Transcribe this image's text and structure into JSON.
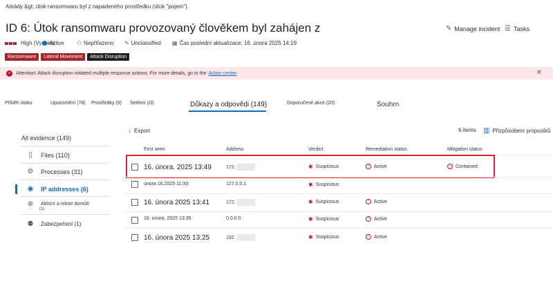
{
  "breadcrumb": "Arkády &gt; útok ransomwaru byl z napadeného prostředku (útok \"pojem\").",
  "title": "ID 6: Útok ransomwaru provozovaný člověkem byl zahájen z compu",
  "header_actions": {
    "manage": "Manage incident",
    "tasks": "Tasks"
  },
  "meta": {
    "severity": "High (Vysoká)",
    "status": "Active",
    "assigned": "Nepřiřazeno",
    "classification": "Unclassified",
    "last_update": "Čas poslední aktualizace: 16. února 2025 14:19"
  },
  "tags": [
    {
      "label": "Ransomware",
      "color": "#a4262c"
    },
    {
      "label": "Lateral Movement",
      "color": "#a4262c"
    },
    {
      "label": "Attack Disruption",
      "color": "#201f1e"
    }
  ],
  "banner": {
    "text": "Attention! Attack disruption initiated multiple response actions. For more details, go to the",
    "link": "Action center",
    "end": "."
  },
  "tabs": [
    "Příběh útoku",
    "Upozornění (78)",
    "Prostředky (9)",
    "Šetření (O)",
    "Důkazy a odpovědi (149)",
    "Doporučené akce (20)",
    "Souhrn"
  ],
  "sidebar": {
    "all": "All evidence (149)",
    "items": [
      {
        "label": "Files (110)"
      },
      {
        "label": "Processes (31)"
      },
      {
        "label": "IP addresses (6)"
      },
      {
        "label": "Aktivní a rektor domů6"
      },
      {
        "label": "Zabezpečení (1)"
      }
    ],
    "sub_count": "(1)"
  },
  "toolbar": {
    "export": "Export",
    "count": "6 items",
    "customize": "Přizpůsobení propustků"
  },
  "table": {
    "headers": [
      "First seen",
      "Address",
      "Verdict",
      "Remediation status",
      "Mitigation status"
    ],
    "rows": [
      {
        "first_seen": "16. února. 2025 13:49",
        "address": "172.",
        "verdict": "Suspicious",
        "remediation": "Active",
        "mitigation": "Contained"
      },
      {
        "first_seen": "února 16.2025 11:3S",
        "address": "127.0.0.1",
        "verdict": "Suspicious",
        "remediation": "",
        "mitigation": ""
      },
      {
        "first_seen": "16. února 2025 13:41",
        "address": "172.",
        "verdict": "Suspicious",
        "remediation": "Active",
        "mitigation": ""
      },
      {
        "first_seen": "16. února. 2025 13:35",
        "address": "0.0.0.0",
        "verdict": "Suspicious",
        "remediation": "Active",
        "mitigation": ""
      },
      {
        "first_seen": "16. února 2025 13:25",
        "address": "192.",
        "verdict": "Suspicious",
        "remediation": "Active",
        "mitigation": ""
      }
    ]
  },
  "colors": {
    "accent": "#0f6cbd",
    "danger": "#c50f1f",
    "highlight": "#e0242b"
  }
}
